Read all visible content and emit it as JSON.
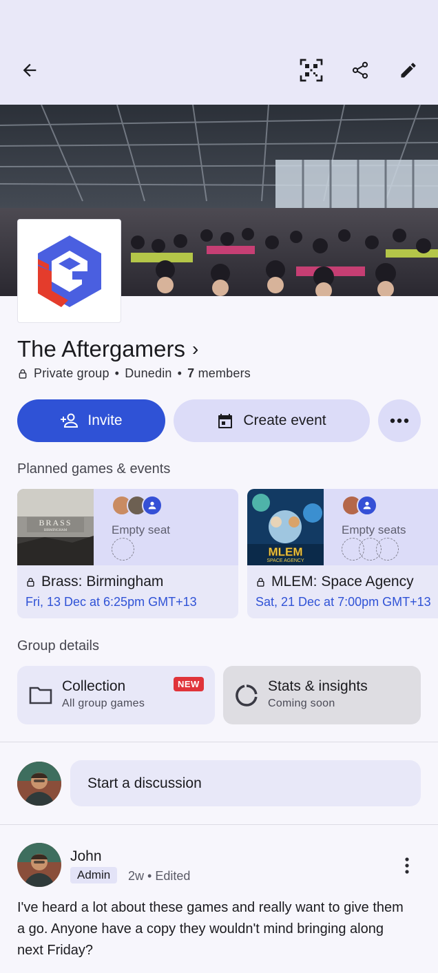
{
  "header": {
    "back_icon": "arrow-back-icon",
    "qr_icon": "qr-code-icon",
    "share_icon": "share-icon",
    "edit_icon": "edit-pencil-icon"
  },
  "group": {
    "name": "The Aftergamers",
    "name_chevron": "›",
    "privacy": "Private group",
    "separator": "•",
    "location": "Dunedin",
    "members_count": "7",
    "members_label": "members"
  },
  "actions": {
    "invite_label": "Invite",
    "create_event_label": "Create event"
  },
  "planned": {
    "title": "Planned games & events",
    "events": [
      {
        "game": "Brass: Birmingham",
        "date": "Fri, 13 Dec at 6:25pm GMT+13",
        "seat_label": "Empty seat",
        "empty_seats": 1,
        "cover_text": "BRASS",
        "cover_sub": "BIRMINGHAM"
      },
      {
        "game": "MLEM: Space Agency",
        "date": "Sat, 21 Dec at 7:00pm GMT+13",
        "seat_label": "Empty seats",
        "empty_seats": 3,
        "cover_text": "MLEM",
        "cover_sub": "SPACE AGENCY"
      }
    ]
  },
  "details": {
    "title": "Group details",
    "collection": {
      "title": "Collection",
      "subtitle": "All group games",
      "badge": "NEW"
    },
    "stats": {
      "title": "Stats & insights",
      "subtitle": "Coming soon"
    }
  },
  "composer": {
    "placeholder": "Start a discussion"
  },
  "post": {
    "author": "John",
    "role": "Admin",
    "meta": "2w • Edited",
    "text": "I've heard a lot about these games and really want to give them a go. Anyone have a copy they wouldn't mind bringing along next Friday?"
  },
  "colors": {
    "accent": "#2f52d6",
    "tonal": "#dcdcf8",
    "badge_red": "#e0343a"
  }
}
